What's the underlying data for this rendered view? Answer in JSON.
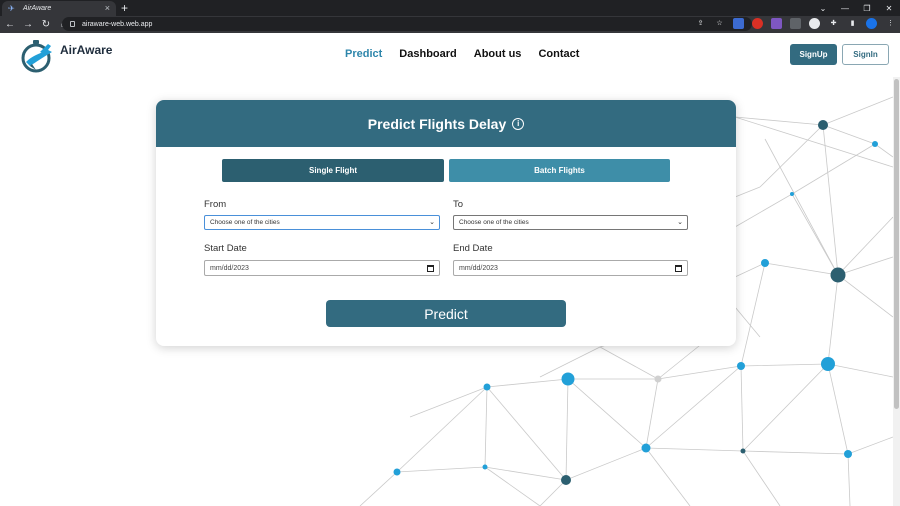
{
  "browser": {
    "tab_title": "AirAware",
    "new_tab": "+",
    "url": "airaware-web.web.app",
    "window_controls": [
      "⌄",
      "—",
      "❐",
      "✕"
    ]
  },
  "header": {
    "logo_text": "AirAware",
    "nav": [
      {
        "label": "Predict",
        "active": true
      },
      {
        "label": "Dashboard",
        "active": false
      },
      {
        "label": "About us",
        "active": false
      },
      {
        "label": "Contact",
        "active": false
      }
    ],
    "signup_label": "SignUp",
    "signin_label": "SignIn"
  },
  "card": {
    "title": "Predict Flights Delay",
    "info_symbol": "i",
    "modes": [
      "Single Flight",
      "Batch Flights"
    ],
    "from_label": "From",
    "from_value": "Choose one of the cities",
    "to_label": "To",
    "to_value": "Choose one of the cities",
    "start_label": "Start Date",
    "start_value": "mm/dd/2023",
    "end_label": "End Date",
    "end_value": "mm/dd/2023",
    "predict_label": "Predict"
  },
  "colors": {
    "primary": "#336b80",
    "single_flight": "#2c5f70",
    "batch_flights": "#3e8ea8",
    "active_nav": "#2e86ab",
    "network_dot_blue": "#22a0d8",
    "network_dot_dark": "#2c5f70"
  }
}
